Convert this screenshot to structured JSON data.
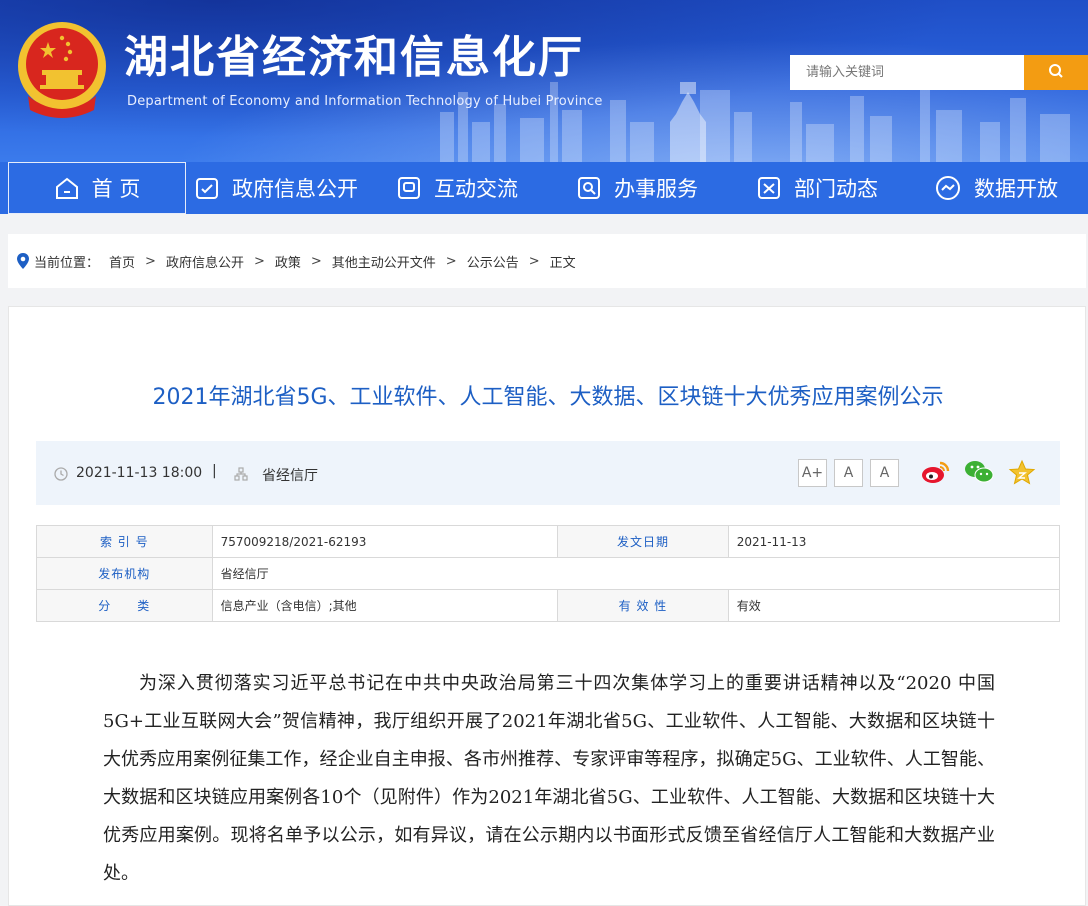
{
  "header": {
    "title": "湖北省经济和信息化厅",
    "subtitle": "Department of Economy and Information Technology of Hubei Province",
    "search_placeholder": "请输入关键词",
    "search_icon": "search-icon"
  },
  "nav": {
    "items": [
      {
        "label": "首 页",
        "icon": "home-icon"
      },
      {
        "label": "政府信息公开",
        "icon": "document-check-icon"
      },
      {
        "label": "互动交流",
        "icon": "chat-icon"
      },
      {
        "label": "办事服务",
        "icon": "service-search-icon"
      },
      {
        "label": "部门动态",
        "icon": "news-icon"
      },
      {
        "label": "数据开放",
        "icon": "data-icon"
      }
    ],
    "active": 0
  },
  "breadcrumb": {
    "label": "当前位置：",
    "items": [
      "首页",
      "政府信息公开",
      "政策",
      "其他主动公开文件",
      "公示公告",
      "正文"
    ]
  },
  "article": {
    "title": "2021年湖北省5G、工业软件、人工智能、大数据、区块链十大优秀应用案例公示",
    "date": "2021-11-13 18:00",
    "divider": "|",
    "source": "省经信厅",
    "font_buttons": [
      "A+",
      "A",
      "A"
    ],
    "share_icons": [
      "weibo-icon",
      "wechat-icon",
      "favorite-star-icon"
    ],
    "info": {
      "index_label": "索 引 号",
      "index_value": "757009218/2021-62193",
      "date_label": "发文日期",
      "date_value": "2021-11-13",
      "org_label": "发布机构",
      "org_value": "省经信厅",
      "category_label": "分　　类",
      "category_value": "信息产业（含电信）;其他",
      "validity_label": "有 效 性",
      "validity_value": "有效"
    },
    "paragraph": "为深入贯彻落实习近平总书记在中共中央政治局第三十四次集体学习上的重要讲话精神以及“2020 中国5G+工业互联网大会”贺信精神，我厅组织开展了2021年湖北省5G、工业软件、人工智能、大数据和区块链十大优秀应用案例征集工作，经企业自主申报、各市州推荐、专家评审等程序，拟确定5G、工业软件、人工智能、大数据和区块链应用案例各10个（见附件）作为2021年湖北省5G、工业软件、人工智能、大数据和区块链十大优秀应用案例。现将名单予以公示，如有异议，请在公示期内以书面形式反馈至省经信厅人工智能和大数据产业处。"
  },
  "colors": {
    "header_blue": "#2a63dd",
    "nav_blue": "#2c6be3",
    "title_blue": "#1d5fc4",
    "search_orange": "#f39c12",
    "emblem_red": "#d8261e",
    "emblem_gold": "#f2c230"
  }
}
